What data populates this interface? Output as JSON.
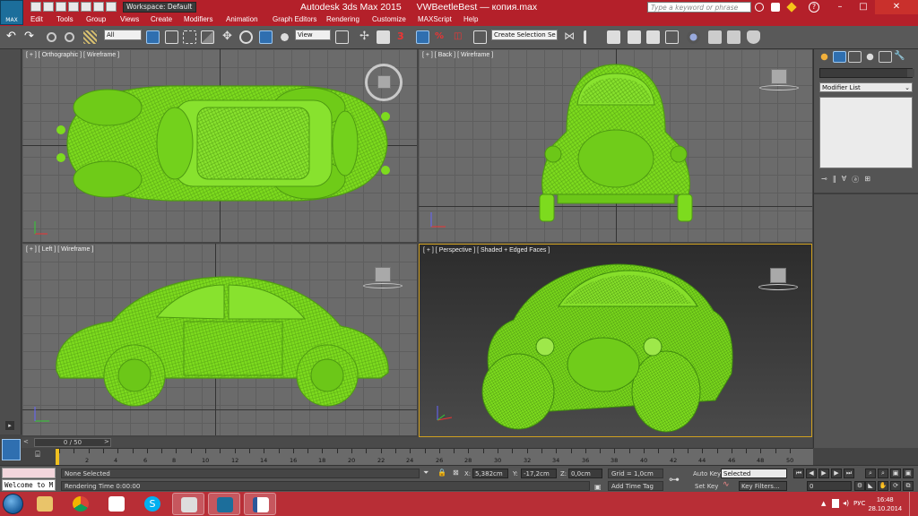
{
  "window": {
    "app_title": "Autodesk 3ds Max  2015",
    "file_title": "VWBeetleBest — копия.max",
    "workspace": "Workspace: Default",
    "search_placeholder": "Type a keyword or phrase",
    "logo_text": "MAX"
  },
  "menu": [
    "Edit",
    "Tools",
    "Group",
    "Views",
    "Create",
    "Modifiers",
    "Animation",
    "Graph Editors",
    "Rendering",
    "Customize",
    "MAXScript",
    "Help"
  ],
  "toolbar": {
    "selection_filter": "All",
    "reference_coord": "View",
    "selection_set": "Create Selection Se"
  },
  "viewports": [
    {
      "id": "top",
      "label": "[ + ] [ Orthographic ] [ Wireframe ]"
    },
    {
      "id": "back",
      "label": "[ + ] [ Back ] [ Wireframe ]"
    },
    {
      "id": "left",
      "label": "[ + ] [ Left ] [ Wireframe ]"
    },
    {
      "id": "perspective",
      "label": "[ + ] [ Perspective ] [ Shaded + Edged Faces ]"
    }
  ],
  "command_panel": {
    "modifier_list": "Modifier List"
  },
  "timeline": {
    "frame_counter": "0 / 50",
    "ticks": [
      "2",
      "4",
      "6",
      "8",
      "10",
      "12",
      "14",
      "16",
      "18",
      "20",
      "22",
      "24",
      "26",
      "28",
      "30",
      "32",
      "34",
      "36",
      "38",
      "40",
      "42",
      "44",
      "46",
      "48",
      "50"
    ]
  },
  "status": {
    "selection": "None Selected",
    "rendering_time": "Rendering Time  0:00:00",
    "x_label": "X:",
    "x_value": "5,382cm",
    "y_label": "Y:",
    "y_value": "-17,2cm",
    "z_label": "Z:",
    "z_value": "0,0cm",
    "grid": "Grid = 1,0cm",
    "add_time_tag": "Add Time Tag",
    "auto_key": "Auto Key",
    "key_mode": "Selected",
    "set_key": "Set Key",
    "key_filters": "Key Filters...",
    "current_frame": "0",
    "listener": "Welcome to M"
  },
  "taskbar": {
    "language": "РУС",
    "time": "16:48",
    "date": "28.10.2014"
  },
  "colors": {
    "titlebar": "#b4202a",
    "wire": "#7ddb1e",
    "taskbar": "#b82e36"
  }
}
